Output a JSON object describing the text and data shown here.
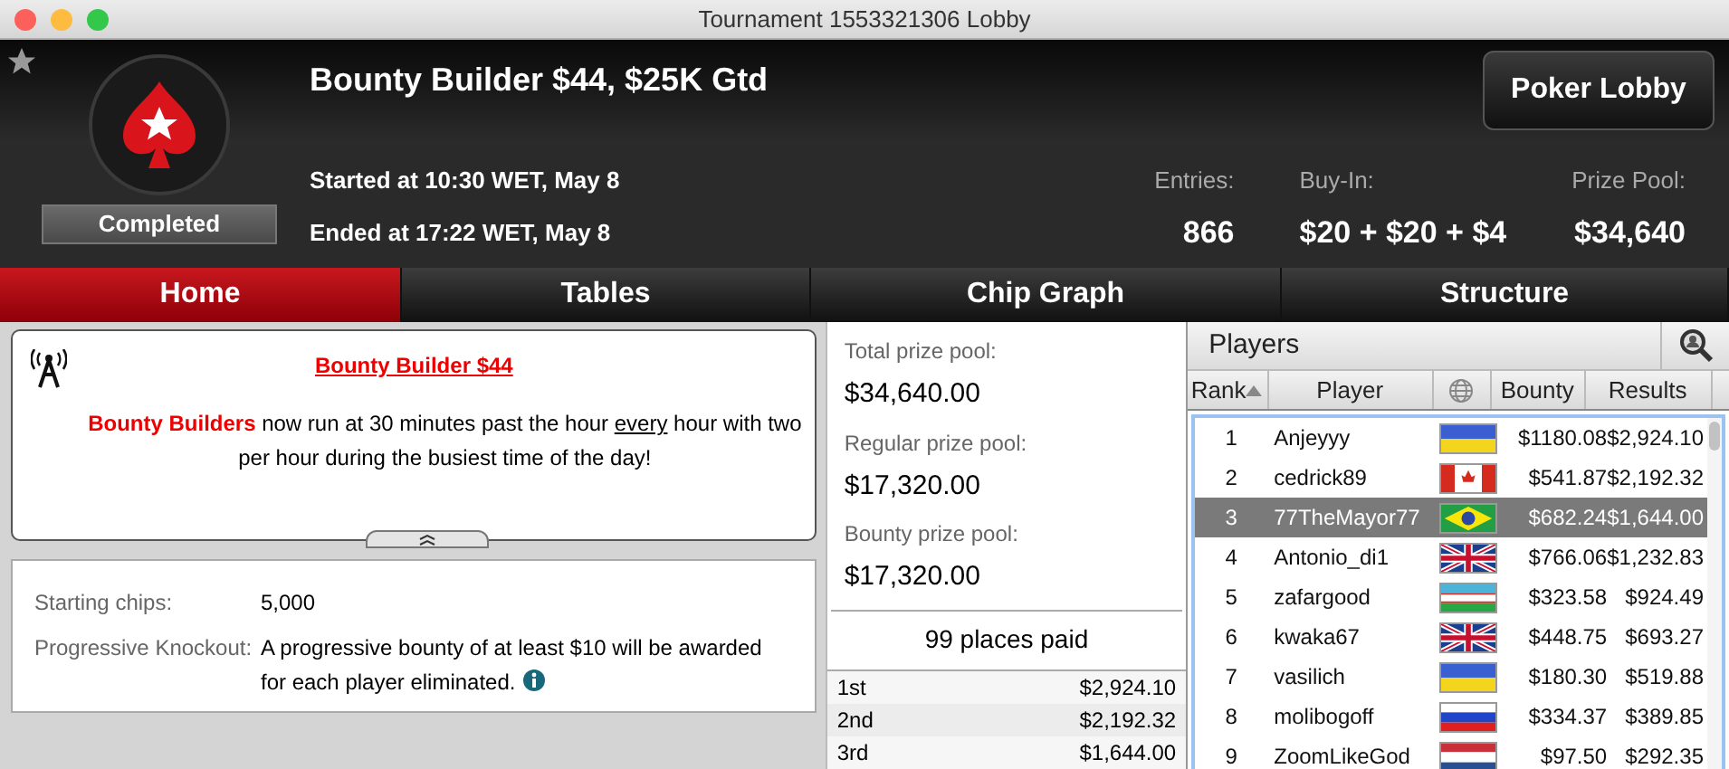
{
  "window": {
    "title": "Tournament 1553321306 Lobby"
  },
  "header": {
    "favorite": false,
    "title": "Bounty Builder $44, $25K Gtd",
    "status": "Completed",
    "started": "Started at 10:30 WET, May 8",
    "ended": "Ended at 17:22 WET, May 8",
    "button": "Poker Lobby",
    "stats": [
      {
        "label": "Entries:",
        "value": "866"
      },
      {
        "label": "Buy-In:",
        "value": "$20 + $20 + $4"
      },
      {
        "label": "Prize Pool:",
        "value": "$34,640"
      }
    ]
  },
  "tabs": [
    {
      "label": "Home",
      "selected": true
    },
    {
      "label": "Tables",
      "selected": false
    },
    {
      "label": "Chip Graph",
      "selected": false
    },
    {
      "label": "Structure",
      "selected": false
    }
  ],
  "news": {
    "headline": "Bounty Builder $44",
    "segments": [
      {
        "text": "Bounty Builders",
        "kind": "highlight"
      },
      {
        "text": " now run at 30 minutes past the hour ",
        "kind": "plain"
      },
      {
        "text": "every",
        "kind": "underline"
      },
      {
        "text": " hour with two per hour during the busiest time of the day!",
        "kind": "plain"
      }
    ]
  },
  "details": [
    {
      "label": "Starting chips:",
      "value": "5,000",
      "info": false
    },
    {
      "label": "Progressive Knockout:",
      "value": "A progressive bounty of at least $10 will be awarded for each player eliminated.",
      "info": true
    }
  ],
  "prizes": {
    "pools": [
      {
        "label": "Total prize pool:",
        "value": "$34,640.00"
      },
      {
        "label": "Regular prize pool:",
        "value": "$17,320.00"
      },
      {
        "label": "Bounty prize pool:",
        "value": "$17,320.00"
      }
    ],
    "places_paid": "99 places paid",
    "payouts": [
      {
        "place": "1st",
        "amount": "$2,924.10"
      },
      {
        "place": "2nd",
        "amount": "$2,192.32"
      },
      {
        "place": "3rd",
        "amount": "$1,644.00"
      }
    ]
  },
  "players": {
    "title": "Players",
    "columns": [
      "Rank",
      "Player",
      "Bounty",
      "Results"
    ],
    "rows": [
      {
        "rank": "1",
        "player": "Anjeyyy",
        "kind": "ua",
        "bounty": "$1180.08",
        "results": "$2,924.10",
        "selected": false
      },
      {
        "rank": "2",
        "player": "cedrick89",
        "kind": "ca",
        "bounty": "$541.87",
        "results": "$2,192.32",
        "selected": false
      },
      {
        "rank": "3",
        "player": "77TheMayor77",
        "kind": "br",
        "bounty": "$682.24",
        "results": "$1,644.00",
        "selected": true
      },
      {
        "rank": "4",
        "player": "Antonio_di1",
        "kind": "gb",
        "bounty": "$766.06",
        "results": "$1,232.83",
        "selected": false
      },
      {
        "rank": "5",
        "player": "zafargood",
        "kind": "uz",
        "bounty": "$323.58",
        "results": "$924.49",
        "selected": false
      },
      {
        "rank": "6",
        "player": "kwaka67",
        "kind": "gb",
        "bounty": "$448.75",
        "results": "$693.27",
        "selected": false
      },
      {
        "rank": "7",
        "player": "vasilich",
        "kind": "ua",
        "bounty": "$180.30",
        "results": "$519.88",
        "selected": false
      },
      {
        "rank": "8",
        "player": "molibogoff",
        "kind": "ru",
        "bounty": "$334.37",
        "results": "$389.85",
        "selected": false
      },
      {
        "rank": "9",
        "player": "ZoomLikeGod",
        "kind": "nl",
        "bounty": "$97.50",
        "results": "$292.35",
        "selected": false
      }
    ]
  }
}
